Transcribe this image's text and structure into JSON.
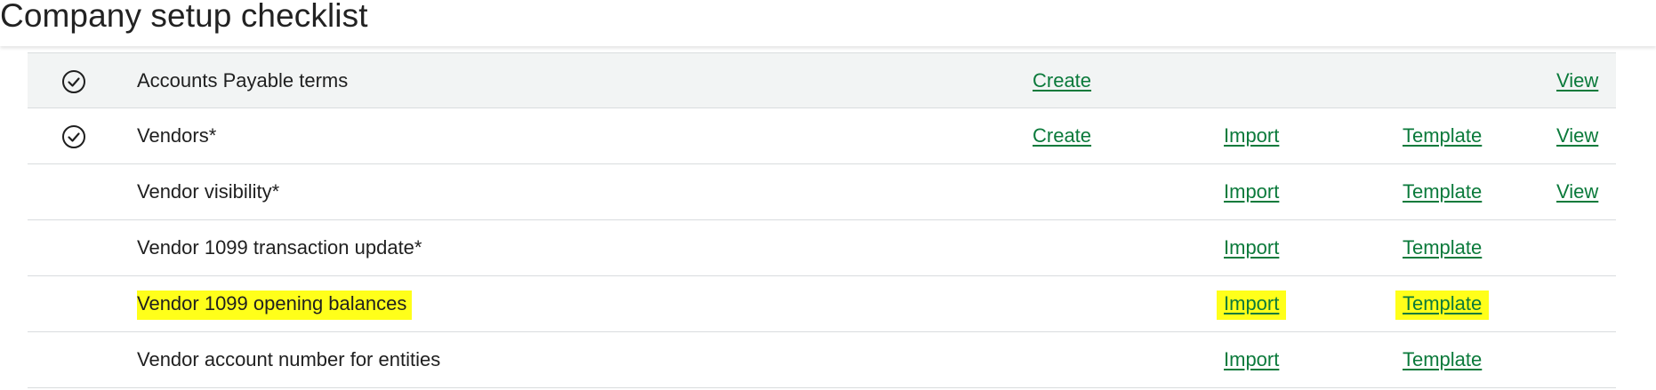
{
  "header": {
    "title": "Company setup checklist"
  },
  "colors": {
    "link": "#0b7a3b",
    "highlight": "#ffff1a",
    "row_shade": "#f2f4f4",
    "divider": "#d9dcde"
  },
  "rows": [
    {
      "label": "Accounts Payable terms",
      "completed": true,
      "status_icon": "check-circle-icon",
      "create": "Create",
      "view": "View"
    },
    {
      "label": "Vendors*",
      "completed": true,
      "status_icon": "check-circle-icon",
      "create": "Create",
      "import": "Import",
      "template": "Template",
      "view": "View"
    },
    {
      "label": "Vendor visibility*",
      "completed": false,
      "import": "Import",
      "template": "Template",
      "view": "View"
    },
    {
      "label": "Vendor 1099 transaction update*",
      "completed": false,
      "import": "Import",
      "template": "Template"
    },
    {
      "label": "Vendor 1099 opening balances",
      "completed": false,
      "highlighted": true,
      "import": "Import",
      "template": "Template"
    },
    {
      "label": "Vendor account number for entities",
      "completed": false,
      "import": "Import",
      "template": "Template"
    }
  ]
}
